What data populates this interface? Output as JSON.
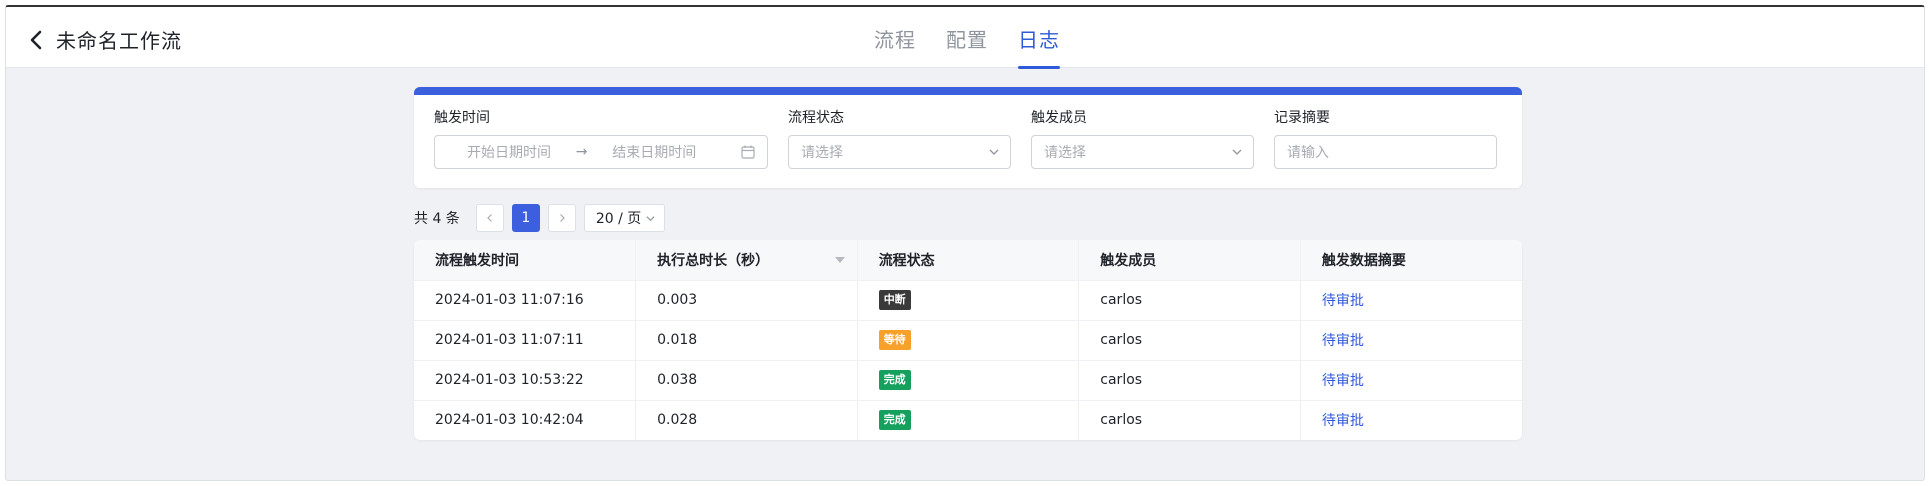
{
  "header": {
    "title": "未命名工作流",
    "tabs": [
      {
        "label": "流程",
        "active": false
      },
      {
        "label": "配置",
        "active": false
      },
      {
        "label": "日志",
        "active": true
      }
    ]
  },
  "colors": {
    "accent": "#2f5bd8",
    "status_interrupted": "#3a3a3a",
    "status_waiting": "#f7a02a",
    "status_done": "#16a05d"
  },
  "filters": {
    "trigger_time": {
      "label": "触发时间",
      "start_placeholder": "开始日期时间",
      "separator": "→",
      "end_placeholder": "结束日期时间"
    },
    "status": {
      "label": "流程状态",
      "placeholder": "请选择"
    },
    "member": {
      "label": "触发成员",
      "placeholder": "请选择"
    },
    "summary": {
      "label": "记录摘要",
      "placeholder": "请输入"
    }
  },
  "pagination": {
    "total": "共 4 条",
    "current_page": "1",
    "page_size": "20 / 页"
  },
  "table": {
    "columns": [
      "流程触发时间",
      "执行总时长（秒）",
      "流程状态",
      "触发成员",
      "触发数据摘要"
    ],
    "rows": [
      {
        "time": "2024-01-03 11:07:16",
        "duration": "0.003",
        "status": "中断",
        "status_color": "#3a3a3a",
        "member": "carlos",
        "summary": "待审批"
      },
      {
        "time": "2024-01-03 11:07:11",
        "duration": "0.018",
        "status": "等待",
        "status_color": "#f7a02a",
        "member": "carlos",
        "summary": "待审批"
      },
      {
        "time": "2024-01-03 10:53:22",
        "duration": "0.038",
        "status": "完成",
        "status_color": "#16a05d",
        "member": "carlos",
        "summary": "待审批"
      },
      {
        "time": "2024-01-03 10:42:04",
        "duration": "0.028",
        "status": "完成",
        "status_color": "#16a05d",
        "member": "carlos",
        "summary": "待审批"
      }
    ]
  }
}
